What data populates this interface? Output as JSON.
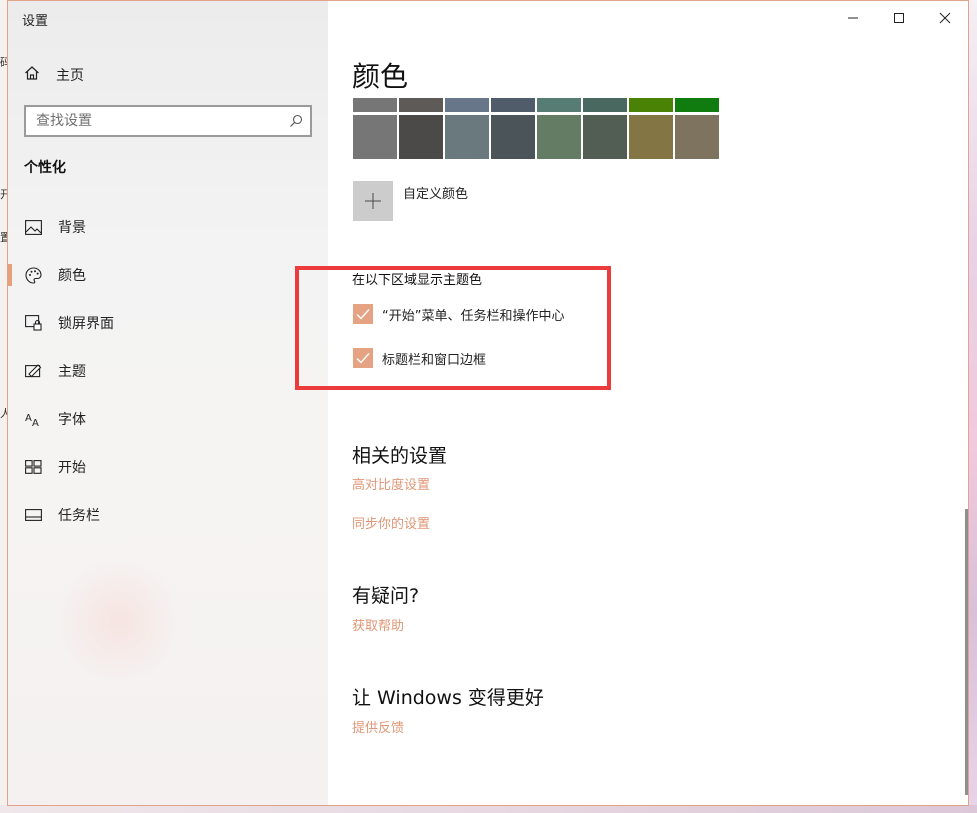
{
  "window": {
    "title": "设置"
  },
  "desktop": {
    "left_fragments": [
      "码",
      "开",
      "置",
      "人"
    ]
  },
  "sidebar": {
    "home_label": "主页",
    "search_placeholder": "查找设置",
    "section_title": "个性化",
    "items": [
      {
        "label": "背景",
        "icon": "picture-icon",
        "active": false
      },
      {
        "label": "颜色",
        "icon": "palette-icon",
        "active": true
      },
      {
        "label": "锁屏界面",
        "icon": "lock-screen-icon",
        "active": false
      },
      {
        "label": "主题",
        "icon": "theme-icon",
        "active": false
      },
      {
        "label": "字体",
        "icon": "font-icon",
        "active": false
      },
      {
        "label": "开始",
        "icon": "start-icon",
        "active": false
      },
      {
        "label": "任务栏",
        "icon": "taskbar-icon",
        "active": false
      }
    ]
  },
  "main": {
    "heading": "颜色",
    "swatches_top": [
      "#767676",
      "#5d5a58",
      "#68768a",
      "#515c6b",
      "#567c73",
      "#486860",
      "#498205",
      "#107c10"
    ],
    "swatches_bottom": [
      "#767676",
      "#4c4a48",
      "#69797e",
      "#4a5459",
      "#647c64",
      "#525e54",
      "#847545",
      "#7e735f"
    ],
    "custom_color_label": "自定义颜色",
    "accent_section_title": "在以下区域显示主题色",
    "checkboxes": [
      {
        "label": "“开始”菜单、任务栏和操作中心",
        "checked": true
      },
      {
        "label": "标题栏和窗口边框",
        "checked": true
      }
    ],
    "accent_color": "#e6a383",
    "highlight_color": "#ec3b3b",
    "related": {
      "title": "相关的设置",
      "links": [
        "高对比度设置",
        "同步你的设置"
      ]
    },
    "questions": {
      "title": "有疑问?",
      "link": "获取帮助"
    },
    "feedback": {
      "title": "让 Windows 变得更好",
      "link": "提供反馈"
    }
  }
}
